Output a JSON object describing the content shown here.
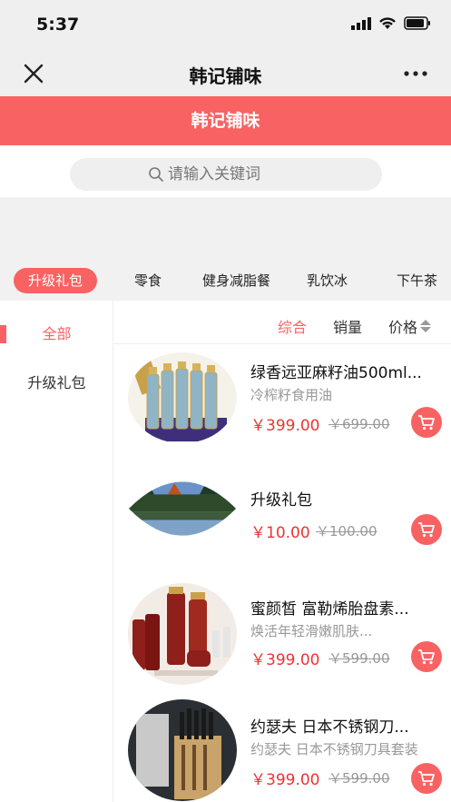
{
  "status": {
    "time": "5:37"
  },
  "nav": {
    "title": "韩记铺味",
    "close_icon": "close-icon",
    "more_icon": "more-icon"
  },
  "shop": {
    "name": "韩记铺味"
  },
  "search": {
    "placeholder": "请输入关键词"
  },
  "tabs": [
    {
      "label": "升级礼包",
      "active": true
    },
    {
      "label": "零食"
    },
    {
      "label": "健身减脂餐"
    },
    {
      "label": "乳饮冰"
    },
    {
      "label": "下午茶"
    }
  ],
  "sidebar": {
    "items": [
      {
        "label": "全部",
        "active": true
      },
      {
        "label": "升级礼包"
      }
    ]
  },
  "sort": {
    "comprehensive": "综合",
    "sales": "销量",
    "price": "价格"
  },
  "products": [
    {
      "title": "绿香远亚麻籽油500ml...",
      "subtitle": "冷榨籽食用油",
      "price": "￥399.00",
      "old_price": "￥699.00"
    },
    {
      "title": "升级礼包",
      "subtitle": "",
      "price": "￥10.00",
      "old_price": "￥100.00"
    },
    {
      "title": "蜜颜皙 富勒烯胎盘素...",
      "subtitle": "焕活年轻滑嫩肌肤...",
      "price": "￥399.00",
      "old_price": "￥599.00"
    },
    {
      "title": "约瑟夫 日本不锈钢刀...",
      "subtitle": "约瑟夫 日本不锈钢刀具套装",
      "price": "￥399.00",
      "old_price": "￥599.00"
    }
  ],
  "colors": {
    "accent": "#f96262",
    "price": "#e33333"
  }
}
